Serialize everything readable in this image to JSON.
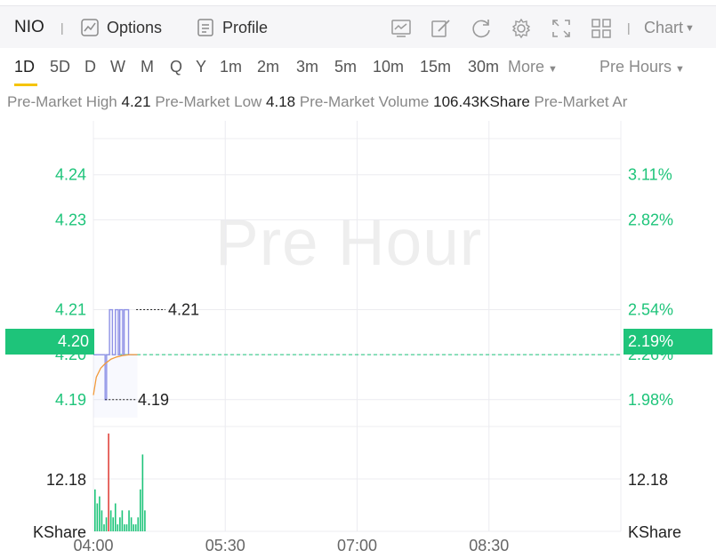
{
  "header": {
    "ticker": "NIO",
    "separator": "|",
    "options_label": "Options",
    "profile_label": "Profile",
    "chart_label": "Chart",
    "tool_icons": [
      "indicator-icon",
      "draw-icon",
      "refresh-icon",
      "settings-icon",
      "fullscreen-icon",
      "layout-icon"
    ]
  },
  "periods": {
    "tabs": [
      "1D",
      "5D",
      "D",
      "W",
      "M",
      "Q",
      "Y",
      "1m",
      "2m",
      "3m",
      "5m",
      "10m",
      "15m",
      "30m"
    ],
    "active": "1D",
    "more_label": "More",
    "session_label": "Pre Hours"
  },
  "info": {
    "high_label": "Pre-Market High",
    "high_value": "4.21",
    "low_label": "Pre-Market Low",
    "low_value": "4.18",
    "volume_label": "Pre-Market Volume",
    "volume_value": "106.43KShare",
    "amount_label": "Pre-Market Ar"
  },
  "chart": {
    "watermark": "Pre Hour",
    "current_price": "4.20",
    "current_pct": "2.19%",
    "max_label": "4.21",
    "min_label": "4.19",
    "volume_tick": "12.18",
    "volume_unit": "KShare"
  },
  "colors": {
    "up": "#1ec47a",
    "down": "#e0443e",
    "price_line": "#8f92e6",
    "avg_line": "#f29a3a",
    "accent": "#f5c400"
  },
  "chart_data": {
    "type": "line",
    "x_ticks": [
      "04:00",
      "05:30",
      "07:00",
      "08:30"
    ],
    "price_axis": {
      "ticks": [
        4.24,
        4.23,
        4.21,
        4.2,
        4.19
      ],
      "tick_labels": [
        "4.24",
        "4.23",
        "4.21",
        "4.20",
        "4.19"
      ],
      "ylim": [
        4.186,
        4.252
      ]
    },
    "percent_axis": {
      "ticks": [
        "3.11%",
        "2.82%",
        "2.54%",
        "2.26%",
        "1.98%"
      ]
    },
    "series": [
      {
        "name": "price",
        "x": [
          "04:00",
          "04:04",
          "04:06",
          "04:08",
          "04:09",
          "04:10",
          "04:11",
          "04:12",
          "04:13",
          "04:14",
          "04:15",
          "04:16",
          "04:17",
          "04:18",
          "04:19",
          "04:20",
          "04:21",
          "04:22",
          "04:24",
          "04:28",
          "04:30"
        ],
        "values": [
          4.2,
          4.2,
          4.2,
          4.19,
          4.2,
          4.2,
          4.21,
          4.21,
          4.2,
          4.2,
          4.21,
          4.21,
          4.2,
          4.21,
          4.21,
          4.2,
          4.21,
          4.21,
          4.2,
          4.2,
          4.2
        ]
      },
      {
        "name": "average",
        "x": [
          "04:00",
          "04:02",
          "04:05",
          "04:08",
          "04:12",
          "04:16",
          "04:20",
          "04:25",
          "04:30"
        ],
        "values": [
          4.191,
          4.195,
          4.197,
          4.198,
          4.199,
          4.1995,
          4.1998,
          4.2,
          4.2
        ]
      }
    ],
    "volume": {
      "values": [
        6,
        4,
        5,
        3,
        1,
        2,
        14,
        3,
        2,
        4,
        1,
        2,
        3,
        1,
        1,
        3,
        2,
        1,
        1,
        2,
        6,
        11,
        3
      ],
      "up": [
        true,
        true,
        true,
        true,
        true,
        true,
        false,
        true,
        true,
        true,
        true,
        true,
        true,
        true,
        true,
        true,
        true,
        true,
        true,
        true,
        true,
        true,
        true
      ],
      "ylim": [
        0,
        15
      ],
      "tick": 12.18
    }
  }
}
